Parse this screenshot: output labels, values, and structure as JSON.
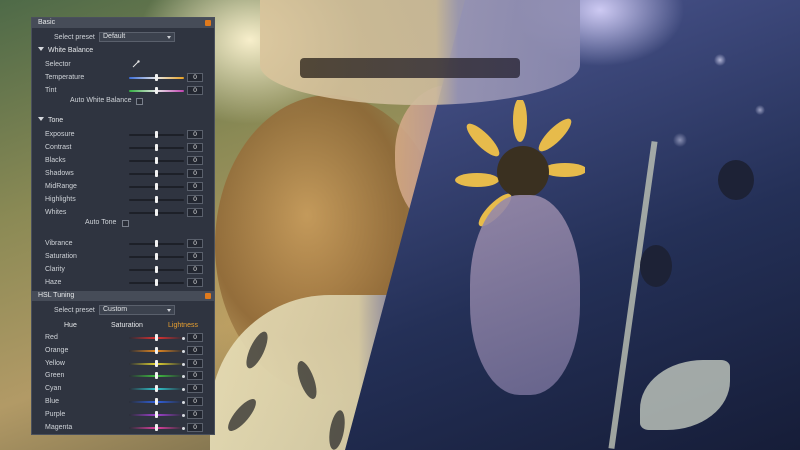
{
  "colors": {
    "accent": "#e07a1c",
    "panel_bg": "#2f3440",
    "section_header": "#464c58",
    "lightness_label": "#e8a030"
  },
  "basic": {
    "title": "Basic",
    "preset_label": "Select preset",
    "preset_value": "Default",
    "white_balance": {
      "title": "White Balance",
      "selector_label": "Selector",
      "selector_icon": "eyedropper-icon",
      "sliders": [
        {
          "label": "Temperature",
          "value": "0",
          "gradient": "temperature"
        },
        {
          "label": "Tint",
          "value": "0",
          "gradient": "tint"
        }
      ],
      "auto_label": "Auto White Balance"
    },
    "tone": {
      "title": "Tone",
      "sliders": [
        {
          "label": "Exposure",
          "value": "0"
        },
        {
          "label": "Contrast",
          "value": "0"
        },
        {
          "label": "Blacks",
          "value": "0"
        },
        {
          "label": "Shadows",
          "value": "0"
        },
        {
          "label": "MidRange",
          "value": "0"
        },
        {
          "label": "Highlights",
          "value": "0"
        },
        {
          "label": "Whites",
          "value": "0"
        }
      ],
      "auto_label": "Auto Tone"
    },
    "presence": [
      {
        "label": "Vibrance",
        "value": "0"
      },
      {
        "label": "Saturation",
        "value": "0"
      },
      {
        "label": "Clarity",
        "value": "0"
      },
      {
        "label": "Haze",
        "value": "0"
      }
    ]
  },
  "hsl": {
    "title": "HSL Tuning",
    "preset_label": "Select preset",
    "preset_value": "Custom",
    "columns": [
      "Hue",
      "Saturation",
      "Lightness"
    ],
    "rows": [
      {
        "label": "Red",
        "value": "0",
        "color": "#e03030"
      },
      {
        "label": "Orange",
        "value": "0",
        "color": "#e88a20"
      },
      {
        "label": "Yellow",
        "value": "0",
        "color": "#e6d630"
      },
      {
        "label": "Green",
        "value": "0",
        "color": "#40c040"
      },
      {
        "label": "Cyan",
        "value": "0",
        "color": "#30c8d0"
      },
      {
        "label": "Blue",
        "value": "0",
        "color": "#3060e0"
      },
      {
        "label": "Purple",
        "value": "0",
        "color": "#a040d0"
      },
      {
        "label": "Magenta",
        "value": "0",
        "color": "#e040a0"
      }
    ]
  }
}
